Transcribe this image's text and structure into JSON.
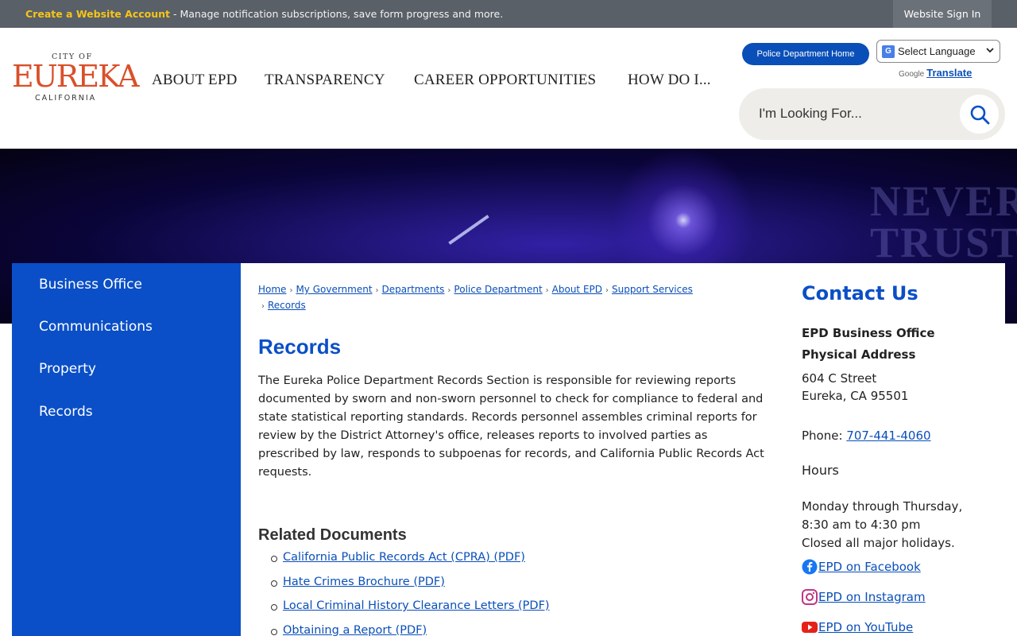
{
  "topbar": {
    "create_link": "Create a Website Account",
    "message": " - Manage notification subscriptions, save form progress and more.",
    "signin": "Website Sign In"
  },
  "logo": {
    "cityof": "CITY OF",
    "name": "EUREKA",
    "state": "CALIFORNIA"
  },
  "nav": [
    {
      "label": "ABOUT EPD"
    },
    {
      "label": "TRANSPARENCY"
    },
    {
      "label": "CAREER OPPORTUNITIES"
    },
    {
      "label": "HOW DO I..."
    }
  ],
  "header": {
    "pd_home": "Police Department Home",
    "language": "Select Language",
    "google": "Google",
    "translate": "Translate",
    "search_placeholder": "I'm Looking For..."
  },
  "sidebar": {
    "items": [
      {
        "label": "Business Office"
      },
      {
        "label": "Communications"
      },
      {
        "label": "Property"
      },
      {
        "label": "Records"
      }
    ]
  },
  "breadcrumb": [
    "Home",
    "My Government",
    "Departments",
    "Police Department",
    "About EPD",
    "Support Services",
    "Records"
  ],
  "main": {
    "title": "Records",
    "description": "The Eureka Police Department Records Section is responsible for reviewing reports documented by sworn and non-sworn personnel to check for compliance to federal and state statistical reporting standards. Records personnel assembles criminal reports for review by the District Attorney's office, releases reports to involved parties as prescribed by law, responds to subpoenas for records, and California Public Records Act requests.",
    "related_title": "Related Documents",
    "documents": [
      "California Public Records Act (CPRA) (PDF)",
      "Hate Crimes Brochure (PDF)",
      "Local Criminal History Clearance Letters (PDF)",
      "Obtaining a Report (PDF)"
    ]
  },
  "contact": {
    "heading": "Contact Us",
    "org": "EPD Business Office",
    "address_label": "Physical Address",
    "street": "604 C Street",
    "city": "Eureka, CA 95501",
    "phone_label": "Phone: ",
    "phone": "707-441-4060",
    "hours_label": "Hours",
    "hours_1": "Monday through Thursday,",
    "hours_2": "8:30 am to 4:30 pm",
    "hours_3": "Closed all major holidays.",
    "facebook": "EPD on Facebook",
    "instagram": "EPD on Instagram",
    "youtube": "EPD on YouTube"
  },
  "hero": {
    "text": "NEVER TRUST"
  },
  "colors": {
    "brand_blue": "#0a4fc7",
    "link_blue": "#0a4fb8",
    "accent_yellow": "#f5c518",
    "logo_orange": "#d9502a"
  }
}
